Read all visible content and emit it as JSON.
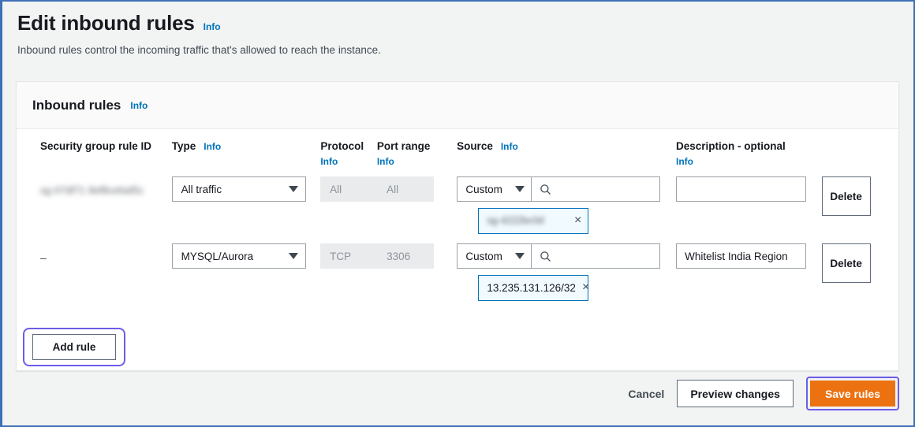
{
  "page": {
    "title": "Edit inbound rules",
    "title_info": "Info",
    "subtitle": "Inbound rules control the incoming traffic that's allowed to reach the instance."
  },
  "card": {
    "title": "Inbound rules",
    "title_info": "Info"
  },
  "columns": {
    "rule_id": "Security group rule ID",
    "type": "Type",
    "type_info": "Info",
    "protocol": "Protocol",
    "protocol_info": "Info",
    "port_range": "Port range",
    "port_range_info": "Info",
    "source": "Source",
    "source_info": "Info",
    "description": "Description - optional",
    "description_info": "Info"
  },
  "rows": [
    {
      "rule_id": "sg-07df71 8ef8ce6af5c",
      "rule_id_redacted": true,
      "type": "All traffic",
      "protocol": "All",
      "port_range": "All",
      "source_type": "Custom",
      "source_search_value": "",
      "source_token": "sg-4222bc0d",
      "source_token_redacted": true,
      "source_token_remove": "×",
      "description": "",
      "delete_label": "Delete"
    },
    {
      "rule_id": "–",
      "rule_id_redacted": false,
      "type": "MYSQL/Aurora",
      "protocol": "TCP",
      "port_range": "3306",
      "source_type": "Custom",
      "source_search_value": "",
      "source_token": "13.235.131.126/32",
      "source_token_redacted": false,
      "source_token_remove": "×",
      "description": "Whitelist India Region",
      "delete_label": "Delete"
    }
  ],
  "actions": {
    "add_rule": "Add rule",
    "cancel": "Cancel",
    "preview_changes": "Preview changes",
    "save_rules": "Save rules"
  },
  "colors": {
    "accent_link": "#0073bb",
    "save_button": "#ec7211",
    "focus_ring": "#6c5ce7",
    "token_border": "#0073bb",
    "page_bg": "#f2f3f3",
    "frame": "#3f6fb5"
  }
}
